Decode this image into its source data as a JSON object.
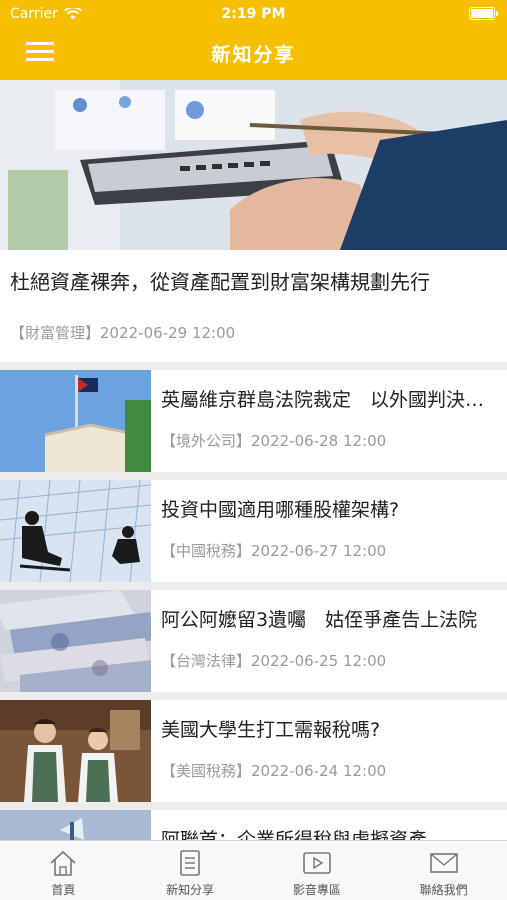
{
  "status_bar": {
    "carrier": "Carrier",
    "time": "2:19 PM"
  },
  "navbar": {
    "title": "新知分享",
    "menu_icon": "hamburger-menu-icon"
  },
  "featured": {
    "title": "杜絕資產裸奔，從資產配置到財富架構規劃先行",
    "category": "【財富管理】",
    "date": "2022-06-29 12:00"
  },
  "articles": [
    {
      "title": "英屬維京群島法院裁定　以外國判決之債務作為不...",
      "category": "【境外公司】",
      "date": "2022-06-28 12:00"
    },
    {
      "title": "投資中國適用哪種股權架構?",
      "category": "【中國稅務】",
      "date": "2022-06-27 12:00"
    },
    {
      "title": "阿公阿嬤留3遺囑　姑侄爭產告上法院",
      "category": "【台灣法律】",
      "date": "2022-06-25 12:00"
    },
    {
      "title": "美國大學生打工需報稅嗎?",
      "category": "【美國稅務】",
      "date": "2022-06-24 12:00"
    },
    {
      "title": "阿聯首：企業所得稅與虛擬資產",
      "category": "",
      "date": ""
    }
  ],
  "tabbar": {
    "tabs": [
      {
        "label": "首頁",
        "icon": "home-icon"
      },
      {
        "label": "新知分享",
        "icon": "document-icon"
      },
      {
        "label": "影音專區",
        "icon": "video-icon"
      },
      {
        "label": "聯絡我們",
        "icon": "mail-icon"
      }
    ]
  }
}
